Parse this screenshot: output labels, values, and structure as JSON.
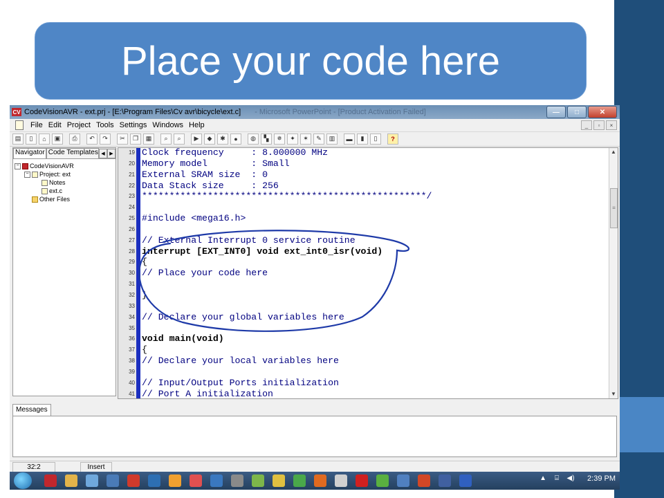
{
  "slide": {
    "title": "Place your code here"
  },
  "window": {
    "title": "CodeVisionAVR - ext.prj - [E:\\Program Files\\Cv avr\\bicycle\\ext.c]",
    "ghost_title": "- Microsoft PowerPoint - [Product Activation Failed]",
    "buttons": {
      "minimize": "—",
      "maximize": "□",
      "close": "✕"
    }
  },
  "menu": {
    "items": [
      "File",
      "Edit",
      "Project",
      "Tools",
      "Settings",
      "Windows",
      "Help"
    ]
  },
  "toolbar": {
    "icons": [
      "project-icon",
      "new-file-icon",
      "open-icon",
      "save-icon",
      "print-icon",
      "undo-icon",
      "redo-icon",
      "cut-icon",
      "copy-icon",
      "paste-icon",
      "find-icon",
      "find-next-icon",
      "compile-icon",
      "make-icon",
      "build-all-icon",
      "stop-icon",
      "debug-icon",
      "chip-programmer-icon",
      "terminal-icon",
      "wizard-icon",
      "bug-icon",
      "pen-icon",
      "calculator-icon",
      "toggle-messages-icon",
      "toggle-navigator-icon",
      "toggle-code-templates-icon",
      "help-icon"
    ],
    "help_label": "?"
  },
  "navigator": {
    "tabs": [
      "Navigator",
      "Code Templates"
    ],
    "tree": [
      {
        "label": "CodeVisionAVR",
        "indent": 0,
        "expander": "⊟",
        "icon": "red"
      },
      {
        "label": "Project: ext",
        "indent": 1,
        "expander": "⊟",
        "icon": "doc"
      },
      {
        "label": "Notes",
        "indent": 2,
        "expander": "",
        "icon": "doc"
      },
      {
        "label": "ext.c",
        "indent": 2,
        "expander": "",
        "icon": "doc"
      },
      {
        "label": "Other Files",
        "indent": 1,
        "expander": "",
        "icon": "folder"
      }
    ]
  },
  "editor": {
    "lines": [
      {
        "n": "19",
        "t": "Clock frequency     : 8.000000 MHz"
      },
      {
        "n": "20",
        "t": "Memory model        : Small"
      },
      {
        "n": "21",
        "t": "External SRAM size  : 0"
      },
      {
        "n": "22",
        "t": "Data Stack size     : 256"
      },
      {
        "n": "23",
        "t": "****************************************************/"
      },
      {
        "n": "24",
        "t": ""
      },
      {
        "n": "25",
        "t": "#include <mega16.h>"
      },
      {
        "n": "26",
        "t": ""
      },
      {
        "n": "27",
        "t": "// External Interrupt 0 service routine"
      },
      {
        "n": "28",
        "t": "interrupt [EXT_INT0] void ext_int0_isr(void)",
        "style": "bold"
      },
      {
        "n": "29",
        "t": "{",
        "style": "plain"
      },
      {
        "n": "30",
        "t": "// Place your code here"
      },
      {
        "n": "31",
        "t": ""
      },
      {
        "n": "32",
        "t": "}",
        "style": "plain"
      },
      {
        "n": "33",
        "t": ""
      },
      {
        "n": "34",
        "t": "// Declare your global variables here"
      },
      {
        "n": "35",
        "t": ""
      },
      {
        "n": "36",
        "t": "void main(void)",
        "style": "bold"
      },
      {
        "n": "37",
        "t": "{",
        "style": "plain"
      },
      {
        "n": "38",
        "t": "// Declare your local variables here"
      },
      {
        "n": "39",
        "t": ""
      },
      {
        "n": "40",
        "t": "// Input/Output Ports initialization"
      },
      {
        "n": "41",
        "t": "// Port A initialization"
      }
    ]
  },
  "messages": {
    "tab": "Messages"
  },
  "status": {
    "position": "32:2",
    "mode": "Insert"
  },
  "taskbar": {
    "icons": [
      {
        "name": "app-icon-1",
        "color": "#c0272d"
      },
      {
        "name": "explorer-icon",
        "color": "#e3b44a"
      },
      {
        "name": "files-icon",
        "color": "#6fa8dc"
      },
      {
        "name": "media-icon",
        "color": "#4a7bb7"
      },
      {
        "name": "app-sw-icon",
        "color": "#d03a2b"
      },
      {
        "name": "plane-icon",
        "color": "#2d6fb3"
      },
      {
        "name": "people-icon",
        "color": "#f0a030"
      },
      {
        "name": "record-icon",
        "color": "#e05050"
      },
      {
        "name": "network-icon",
        "color": "#3a78c0"
      },
      {
        "name": "video-icon",
        "color": "#8a8a8a"
      },
      {
        "name": "notepad-icon",
        "color": "#7db64a"
      },
      {
        "name": "chrome-icon",
        "color": "#e0c040"
      },
      {
        "name": "leaf-icon",
        "color": "#4aa84a"
      },
      {
        "name": "firefox-icon",
        "color": "#e06a20"
      },
      {
        "name": "disc-icon",
        "color": "#d0d0d0"
      },
      {
        "name": "opera-icon",
        "color": "#d02020"
      },
      {
        "name": "torrent-icon",
        "color": "#5ab040"
      },
      {
        "name": "globe-icon",
        "color": "#5080c0"
      },
      {
        "name": "powerpoint-icon",
        "color": "#d24726"
      },
      {
        "name": "player-icon",
        "color": "#4060a0"
      },
      {
        "name": "isis-icon",
        "color": "#3060c0"
      }
    ],
    "tray_up": "▲",
    "clock": "2:39 PM"
  }
}
